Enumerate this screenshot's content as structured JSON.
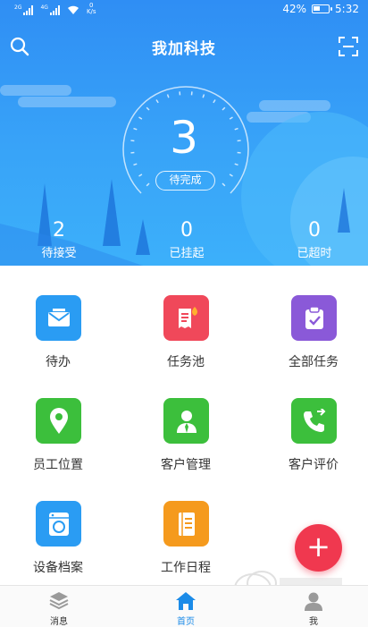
{
  "status_bar": {
    "sim1": "2G",
    "sim2": "4G",
    "speed_value": "0",
    "speed_unit": "K/s",
    "battery": "42%",
    "time": "5:32"
  },
  "header": {
    "title": "我加科技"
  },
  "dashboard": {
    "main_count": "3",
    "main_label": "待完成",
    "stats": [
      {
        "value": "2",
        "label": "待接受"
      },
      {
        "value": "0",
        "label": "已挂起"
      },
      {
        "value": "0",
        "label": "已超时"
      }
    ]
  },
  "grid": {
    "items": [
      {
        "label": "待办",
        "icon": "envelope-icon",
        "color": "#2a9cf3"
      },
      {
        "label": "任务池",
        "icon": "receipt-fire-icon",
        "color": "#f0485a"
      },
      {
        "label": "全部任务",
        "icon": "clipboard-check-icon",
        "color": "#8a59d8"
      },
      {
        "label": "员工位置",
        "icon": "map-pin-icon",
        "color": "#3cbf3c"
      },
      {
        "label": "客户管理",
        "icon": "person-icon",
        "color": "#3cbf3c"
      },
      {
        "label": "客户评价",
        "icon": "phone-icon",
        "color": "#3cbf3c"
      },
      {
        "label": "设备档案",
        "icon": "washer-icon",
        "color": "#2a9cf3"
      },
      {
        "label": "工作日程",
        "icon": "notebook-icon",
        "color": "#f59a1d"
      }
    ]
  },
  "tabbar": {
    "tabs": [
      {
        "label": "消息",
        "icon": "layers-icon"
      },
      {
        "label": "首页",
        "icon": "home-icon",
        "active": true
      },
      {
        "label": "我",
        "icon": "user-icon"
      }
    ]
  },
  "colors": {
    "header_blue": "#2f8ef4",
    "active_tab": "#1b8be8",
    "fab_red": "#f0384f"
  }
}
